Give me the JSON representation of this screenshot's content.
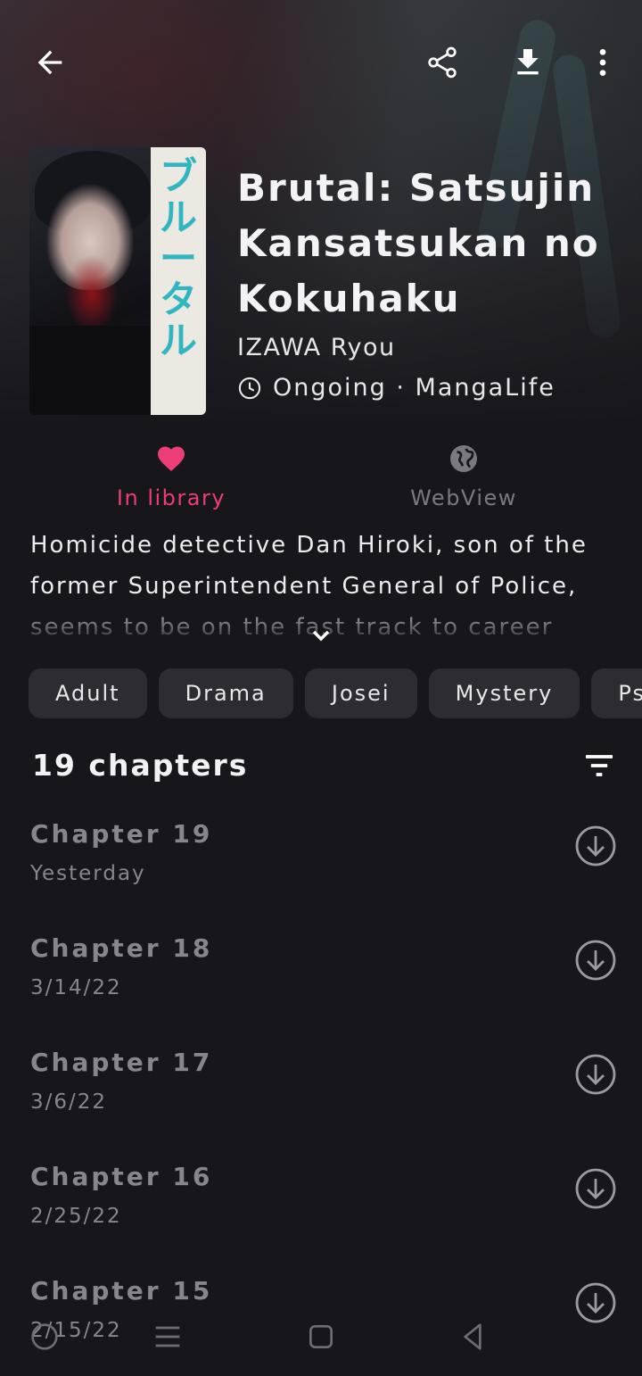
{
  "manga": {
    "title": "Brutal: Satsujin Kansatsukan no Kokuhaku",
    "author": "IZAWA Ryou",
    "status": "Ongoing · MangaLife",
    "description": "Homicide detective Dan Hiroki, son of the former Superintendent General of Police, seems to be on the fast track to career"
  },
  "actions": {
    "library_label": "In library",
    "webview_label": "WebView",
    "library_color": "#ec3d78",
    "webview_color": "#7a7980"
  },
  "genres": [
    "Adult",
    "Drama",
    "Josei",
    "Mystery",
    "Psychological"
  ],
  "chapters_header": "19 chapters",
  "chapters": [
    {
      "name": "Chapter 19",
      "date": "Yesterday"
    },
    {
      "name": "Chapter 18",
      "date": "3/14/22"
    },
    {
      "name": "Chapter 17",
      "date": "3/6/22"
    },
    {
      "name": "Chapter 16",
      "date": "2/25/22"
    },
    {
      "name": "Chapter 15",
      "date": "2/15/22"
    }
  ],
  "icons": {
    "back": "arrow-left-icon",
    "share": "share-icon",
    "download": "download-icon",
    "menu": "more-vert-icon",
    "status": "clock-icon",
    "filter": "filter-icon",
    "chapter_download": "circle-arrow-down-icon"
  },
  "colors": {
    "background": "#17161c",
    "chip": "#2d2c33",
    "accent": "#ec3d78"
  }
}
